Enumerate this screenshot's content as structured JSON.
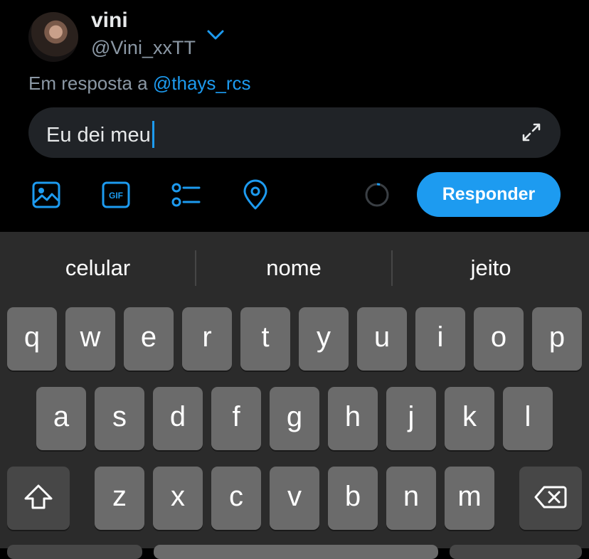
{
  "account": {
    "display_name": "vini",
    "handle": "@Vini_xxTT"
  },
  "reply_context": {
    "prefix": "Em resposta a",
    "mention": "@thays_rcs"
  },
  "composer": {
    "text": "Eu dei meu"
  },
  "toolbar": {
    "reply_label": "Responder"
  },
  "suggestions": [
    "celular",
    "nome",
    "jeito"
  ],
  "keyboard": {
    "row1": [
      "q",
      "w",
      "e",
      "r",
      "t",
      "y",
      "u",
      "i",
      "o",
      "p"
    ],
    "row2": [
      "a",
      "s",
      "d",
      "f",
      "g",
      "h",
      "j",
      "k",
      "l"
    ],
    "row3": [
      "z",
      "x",
      "c",
      "v",
      "b",
      "n",
      "m"
    ]
  },
  "colors": {
    "accent": "#1d9bf0",
    "background": "#000000",
    "keyboard_bg": "#2b2b2b",
    "key": "#6b6b6b"
  },
  "icons": [
    "chevron-down-icon",
    "expand-icon",
    "image-icon",
    "gif-icon",
    "poll-icon",
    "location-icon",
    "shift-icon",
    "backspace-icon"
  ]
}
